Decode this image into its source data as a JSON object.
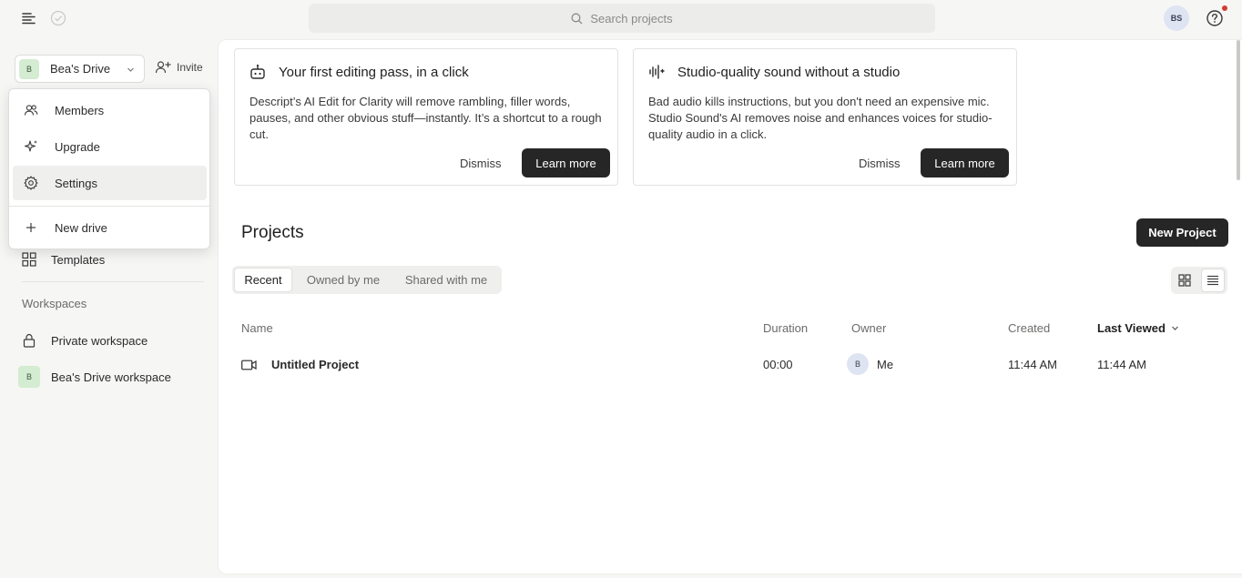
{
  "topbar": {
    "search_placeholder": "Search projects",
    "user_initials": "BS"
  },
  "sidebar": {
    "drive": {
      "badge": "B",
      "name": "Bea's Drive"
    },
    "invite_label": "Invite",
    "items": [
      {
        "label": "Templates",
        "icon": "templates-icon"
      }
    ],
    "workspaces_heading": "Workspaces",
    "workspaces": [
      {
        "label": "Private workspace",
        "icon": "lock-icon"
      },
      {
        "label": "Bea's Drive workspace",
        "badge": "B"
      }
    ]
  },
  "dropdown": {
    "items": [
      {
        "label": "Members",
        "icon": "members-icon"
      },
      {
        "label": "Upgrade",
        "icon": "sparkle-icon"
      },
      {
        "label": "Settings",
        "icon": "gear-icon",
        "active": true
      },
      {
        "label": "New drive",
        "icon": "plus-icon"
      }
    ]
  },
  "cards": [
    {
      "title": "Your first editing pass, in a click",
      "body": "Descript’s AI Edit for Clarity will remove rambling, filler words, pauses, and other obvious stuff—instantly. It’s a shortcut to a rough cut.",
      "dismiss": "Dismiss",
      "learn_more": "Learn more"
    },
    {
      "title": "Studio-quality sound without a studio",
      "body": "Bad audio kills instructions, but you don't need an expensive mic. Studio Sound's AI removes noise and enhances voices for studio-quality audio in a click.",
      "dismiss": "Dismiss",
      "learn_more": "Learn more"
    }
  ],
  "projects": {
    "title": "Projects",
    "new_project": "New Project",
    "tabs": [
      "Recent",
      "Owned by me",
      "Shared with me"
    ],
    "active_tab": "Recent",
    "view_mode": "list",
    "columns": {
      "name": "Name",
      "duration": "Duration",
      "owner": "Owner",
      "created": "Created",
      "last_viewed": "Last Viewed"
    },
    "sorted_by": "Last Viewed",
    "rows": [
      {
        "name": "Untitled Project",
        "duration": "00:00",
        "owner_initial": "B",
        "owner": "Me",
        "created": "11:44 AM",
        "last_viewed": "11:44 AM"
      }
    ]
  },
  "colors": {
    "accent_dark": "#262626",
    "drive_badge": "#d4ecd1",
    "avatar_bg": "#dfe4f2",
    "notification": "#d63a2f"
  }
}
